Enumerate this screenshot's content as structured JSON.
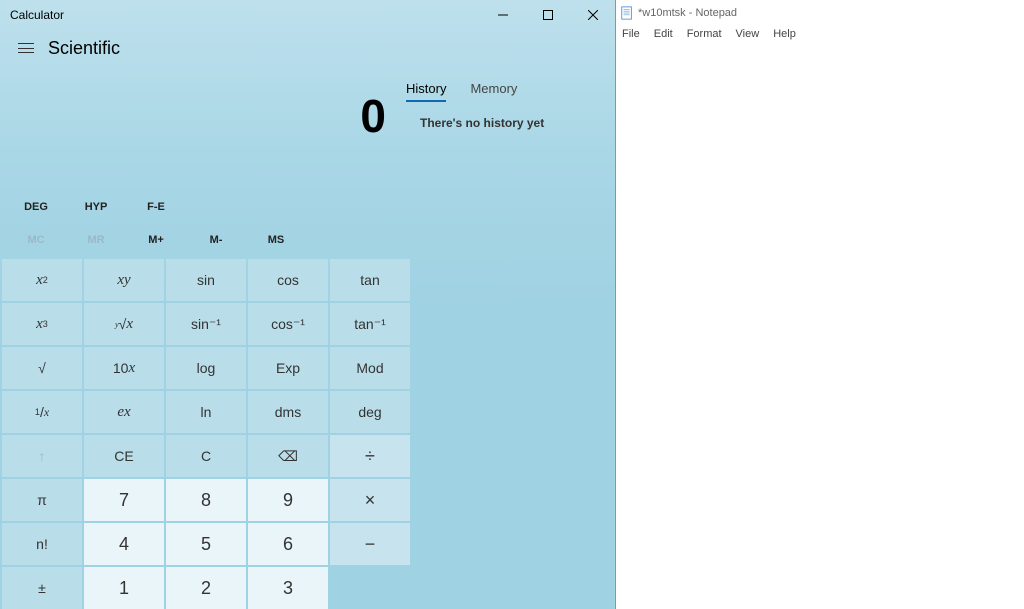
{
  "calc": {
    "title": "Calculator",
    "mode_title": "Scientific",
    "display": "0",
    "tabs": {
      "history": "History",
      "memory": "Memory"
    },
    "history_empty": "There's no history yet",
    "mode_buttons": {
      "deg": "DEG",
      "hyp": "HYP",
      "fe": "F-E"
    },
    "memory_buttons": {
      "mc": "MC",
      "mr": "MR",
      "mplus": "M+",
      "mminus": "M-",
      "ms": "MS"
    },
    "fn": {
      "sin": "sin",
      "cos": "cos",
      "tan": "tan",
      "asin": "sin⁻¹",
      "acos": "cos⁻¹",
      "atan": "tan⁻¹",
      "log": "log",
      "exp": "Exp",
      "mod": "Mod",
      "ln": "ln",
      "dms": "dms",
      "deg": "deg",
      "ce": "CE",
      "c": "C",
      "pi": "π",
      "fact": "n!",
      "pm": "±"
    },
    "digits": {
      "d1": "1",
      "d2": "2",
      "d3": "3",
      "d4": "4",
      "d5": "5",
      "d6": "6",
      "d7": "7",
      "d8": "8",
      "d9": "9"
    },
    "ops": {
      "div": "÷",
      "mul": "×",
      "sub": "−",
      "bksp": "⌫"
    }
  },
  "notepad": {
    "title": "*w10mtsk - Notepad",
    "menu": {
      "file": "File",
      "edit": "Edit",
      "format": "Format",
      "view": "View",
      "help": "Help"
    }
  }
}
